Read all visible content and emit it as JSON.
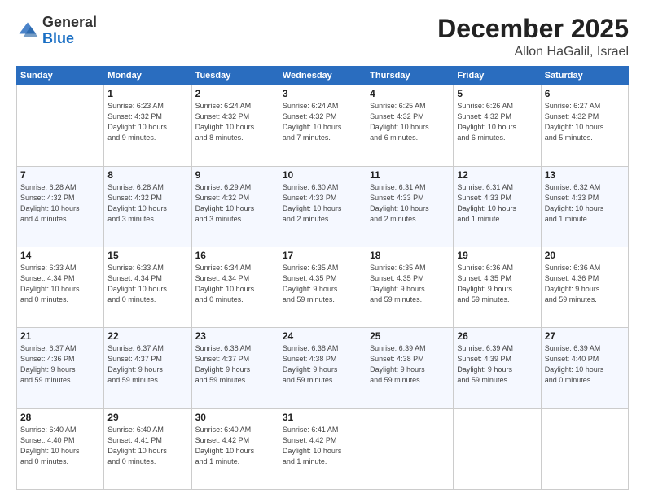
{
  "header": {
    "logo_general": "General",
    "logo_blue": "Blue",
    "month": "December 2025",
    "location": "Allon HaGalil, Israel"
  },
  "days_of_week": [
    "Sunday",
    "Monday",
    "Tuesday",
    "Wednesday",
    "Thursday",
    "Friday",
    "Saturday"
  ],
  "weeks": [
    [
      {
        "day": "",
        "info": ""
      },
      {
        "day": "1",
        "info": "Sunrise: 6:23 AM\nSunset: 4:32 PM\nDaylight: 10 hours\nand 9 minutes."
      },
      {
        "day": "2",
        "info": "Sunrise: 6:24 AM\nSunset: 4:32 PM\nDaylight: 10 hours\nand 8 minutes."
      },
      {
        "day": "3",
        "info": "Sunrise: 6:24 AM\nSunset: 4:32 PM\nDaylight: 10 hours\nand 7 minutes."
      },
      {
        "day": "4",
        "info": "Sunrise: 6:25 AM\nSunset: 4:32 PM\nDaylight: 10 hours\nand 6 minutes."
      },
      {
        "day": "5",
        "info": "Sunrise: 6:26 AM\nSunset: 4:32 PM\nDaylight: 10 hours\nand 6 minutes."
      },
      {
        "day": "6",
        "info": "Sunrise: 6:27 AM\nSunset: 4:32 PM\nDaylight: 10 hours\nand 5 minutes."
      }
    ],
    [
      {
        "day": "7",
        "info": "Sunrise: 6:28 AM\nSunset: 4:32 PM\nDaylight: 10 hours\nand 4 minutes."
      },
      {
        "day": "8",
        "info": "Sunrise: 6:28 AM\nSunset: 4:32 PM\nDaylight: 10 hours\nand 3 minutes."
      },
      {
        "day": "9",
        "info": "Sunrise: 6:29 AM\nSunset: 4:32 PM\nDaylight: 10 hours\nand 3 minutes."
      },
      {
        "day": "10",
        "info": "Sunrise: 6:30 AM\nSunset: 4:33 PM\nDaylight: 10 hours\nand 2 minutes."
      },
      {
        "day": "11",
        "info": "Sunrise: 6:31 AM\nSunset: 4:33 PM\nDaylight: 10 hours\nand 2 minutes."
      },
      {
        "day": "12",
        "info": "Sunrise: 6:31 AM\nSunset: 4:33 PM\nDaylight: 10 hours\nand 1 minute."
      },
      {
        "day": "13",
        "info": "Sunrise: 6:32 AM\nSunset: 4:33 PM\nDaylight: 10 hours\nand 1 minute."
      }
    ],
    [
      {
        "day": "14",
        "info": "Sunrise: 6:33 AM\nSunset: 4:34 PM\nDaylight: 10 hours\nand 0 minutes."
      },
      {
        "day": "15",
        "info": "Sunrise: 6:33 AM\nSunset: 4:34 PM\nDaylight: 10 hours\nand 0 minutes."
      },
      {
        "day": "16",
        "info": "Sunrise: 6:34 AM\nSunset: 4:34 PM\nDaylight: 10 hours\nand 0 minutes."
      },
      {
        "day": "17",
        "info": "Sunrise: 6:35 AM\nSunset: 4:35 PM\nDaylight: 9 hours\nand 59 minutes."
      },
      {
        "day": "18",
        "info": "Sunrise: 6:35 AM\nSunset: 4:35 PM\nDaylight: 9 hours\nand 59 minutes."
      },
      {
        "day": "19",
        "info": "Sunrise: 6:36 AM\nSunset: 4:35 PM\nDaylight: 9 hours\nand 59 minutes."
      },
      {
        "day": "20",
        "info": "Sunrise: 6:36 AM\nSunset: 4:36 PM\nDaylight: 9 hours\nand 59 minutes."
      }
    ],
    [
      {
        "day": "21",
        "info": "Sunrise: 6:37 AM\nSunset: 4:36 PM\nDaylight: 9 hours\nand 59 minutes."
      },
      {
        "day": "22",
        "info": "Sunrise: 6:37 AM\nSunset: 4:37 PM\nDaylight: 9 hours\nand 59 minutes."
      },
      {
        "day": "23",
        "info": "Sunrise: 6:38 AM\nSunset: 4:37 PM\nDaylight: 9 hours\nand 59 minutes."
      },
      {
        "day": "24",
        "info": "Sunrise: 6:38 AM\nSunset: 4:38 PM\nDaylight: 9 hours\nand 59 minutes."
      },
      {
        "day": "25",
        "info": "Sunrise: 6:39 AM\nSunset: 4:38 PM\nDaylight: 9 hours\nand 59 minutes."
      },
      {
        "day": "26",
        "info": "Sunrise: 6:39 AM\nSunset: 4:39 PM\nDaylight: 9 hours\nand 59 minutes."
      },
      {
        "day": "27",
        "info": "Sunrise: 6:39 AM\nSunset: 4:40 PM\nDaylight: 10 hours\nand 0 minutes."
      }
    ],
    [
      {
        "day": "28",
        "info": "Sunrise: 6:40 AM\nSunset: 4:40 PM\nDaylight: 10 hours\nand 0 minutes."
      },
      {
        "day": "29",
        "info": "Sunrise: 6:40 AM\nSunset: 4:41 PM\nDaylight: 10 hours\nand 0 minutes."
      },
      {
        "day": "30",
        "info": "Sunrise: 6:40 AM\nSunset: 4:42 PM\nDaylight: 10 hours\nand 1 minute."
      },
      {
        "day": "31",
        "info": "Sunrise: 6:41 AM\nSunset: 4:42 PM\nDaylight: 10 hours\nand 1 minute."
      },
      {
        "day": "",
        "info": ""
      },
      {
        "day": "",
        "info": ""
      },
      {
        "day": "",
        "info": ""
      }
    ]
  ]
}
